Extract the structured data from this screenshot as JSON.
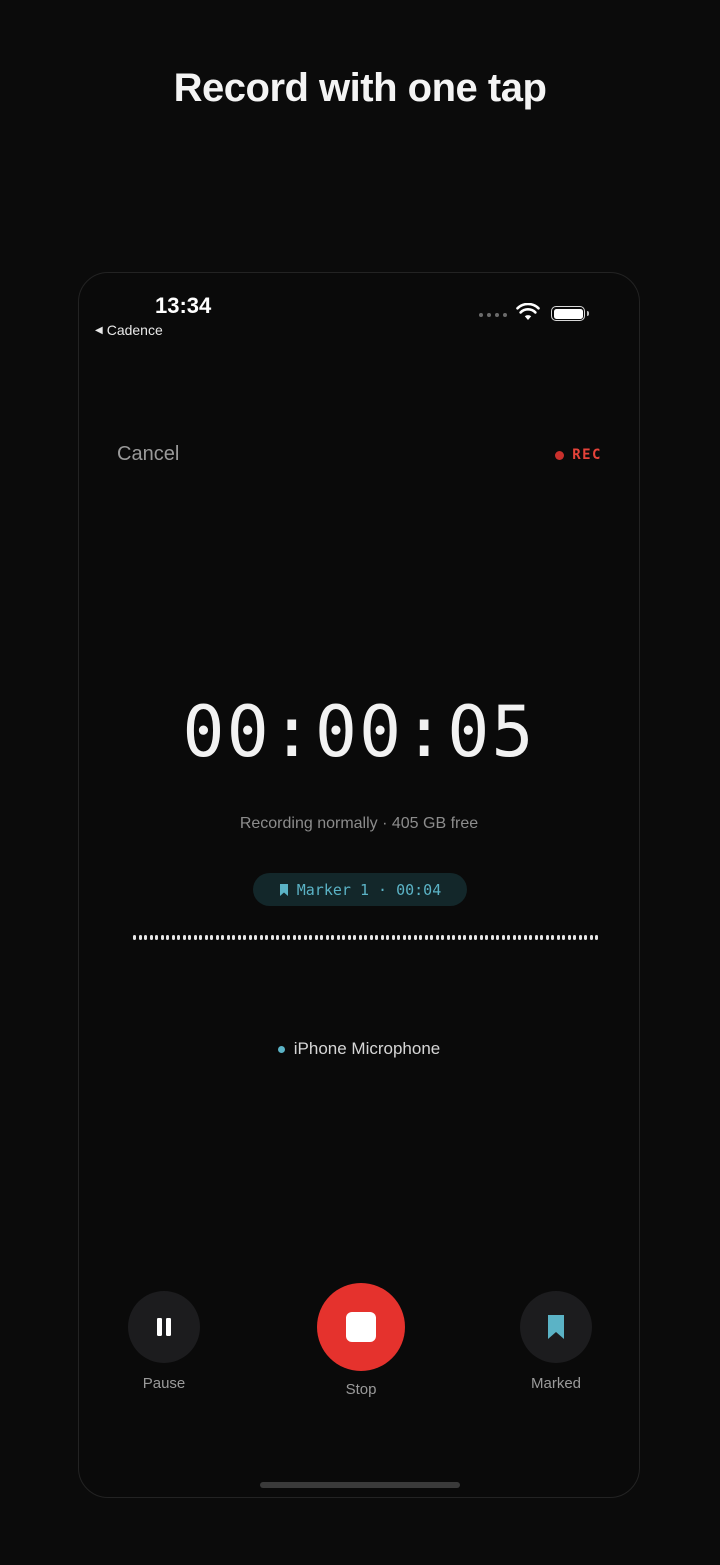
{
  "headline": "Record with one tap",
  "status_bar": {
    "time": "13:34",
    "back_app": "Cadence"
  },
  "top_bar": {
    "cancel": "Cancel",
    "rec_label": "REC"
  },
  "recorder": {
    "timer": "00:00:05",
    "status_text": "Recording normally · 405 GB free",
    "marker_chip": "Marker 1 · 00:04",
    "input_source": "iPhone Microphone"
  },
  "controls": {
    "pause_label": "Pause",
    "stop_label": "Stop",
    "marked_label": "Marked"
  },
  "colors": {
    "background": "#0b0b0b",
    "rec_red": "#e5433a",
    "stop_red": "#e5322d",
    "accent_teal": "#5bb3c6"
  },
  "icons": [
    "back-triangle-icon",
    "wifi-icon",
    "battery-icon",
    "bookmark-icon",
    "pause-icon",
    "stop-icon"
  ]
}
